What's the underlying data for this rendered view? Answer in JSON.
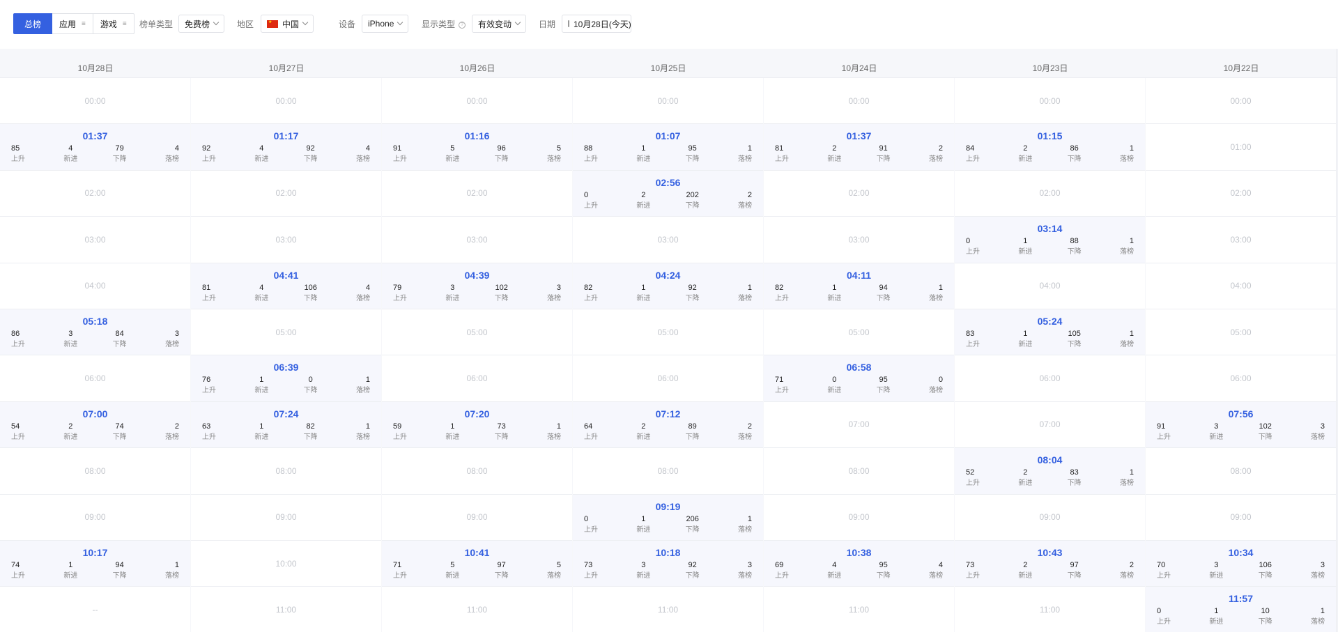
{
  "toolbar": {
    "segments": [
      {
        "label": "总榜",
        "active": true
      },
      {
        "label": "应用",
        "active": false
      },
      {
        "label": "游戏",
        "active": false
      }
    ],
    "list_type_label": "榜单类型",
    "list_type_value": "免费榜",
    "region_label": "地区",
    "region_value": "中国",
    "device_label": "设备",
    "device_value": "iPhone",
    "display_type_label": "显示类型",
    "display_type_value": "有效变动",
    "date_label": "日期",
    "date_value": "10月28日(今天)"
  },
  "stat_keys": [
    "上升",
    "新进",
    "下降",
    "落榜"
  ],
  "columns": [
    {
      "date": "10月28日",
      "rows": [
        {
          "time": "00:00"
        },
        {
          "time": "01:37",
          "stats": [
            85,
            4,
            79,
            4
          ]
        },
        {
          "time": "02:00"
        },
        {
          "time": "03:00"
        },
        {
          "time": "04:00"
        },
        {
          "time": "05:18",
          "stats": [
            86,
            3,
            84,
            3
          ]
        },
        {
          "time": "06:00"
        },
        {
          "time": "07:00",
          "stats": [
            54,
            2,
            74,
            2
          ]
        },
        {
          "time": "08:00"
        },
        {
          "time": "09:00"
        },
        {
          "time": "10:17",
          "stats": [
            74,
            1,
            94,
            1
          ]
        },
        {
          "time": "--"
        }
      ]
    },
    {
      "date": "10月27日",
      "rows": [
        {
          "time": "00:00"
        },
        {
          "time": "01:17",
          "stats": [
            92,
            4,
            92,
            4
          ]
        },
        {
          "time": "02:00"
        },
        {
          "time": "03:00"
        },
        {
          "time": "04:41",
          "stats": [
            81,
            4,
            106,
            4
          ]
        },
        {
          "time": "05:00"
        },
        {
          "time": "06:39",
          "stats": [
            76,
            1,
            0,
            1
          ]
        },
        {
          "time": "07:24",
          "stats": [
            63,
            1,
            82,
            1
          ]
        },
        {
          "time": "08:00"
        },
        {
          "time": "09:00"
        },
        {
          "time": "10:00"
        },
        {
          "time": "11:00"
        }
      ]
    },
    {
      "date": "10月26日",
      "rows": [
        {
          "time": "00:00"
        },
        {
          "time": "01:16",
          "stats": [
            91,
            5,
            96,
            5
          ]
        },
        {
          "time": "02:00"
        },
        {
          "time": "03:00"
        },
        {
          "time": "04:39",
          "stats": [
            79,
            3,
            102,
            3
          ]
        },
        {
          "time": "05:00"
        },
        {
          "time": "06:00"
        },
        {
          "time": "07:20",
          "stats": [
            59,
            1,
            73,
            1
          ]
        },
        {
          "time": "08:00"
        },
        {
          "time": "09:00"
        },
        {
          "time": "10:41",
          "stats": [
            71,
            5,
            97,
            5
          ]
        },
        {
          "time": "11:00"
        }
      ]
    },
    {
      "date": "10月25日",
      "rows": [
        {
          "time": "00:00"
        },
        {
          "time": "01:07",
          "stats": [
            88,
            1,
            95,
            1
          ]
        },
        {
          "time": "02:56",
          "stats": [
            0,
            2,
            202,
            2
          ]
        },
        {
          "time": "03:00"
        },
        {
          "time": "04:24",
          "stats": [
            82,
            1,
            92,
            1
          ]
        },
        {
          "time": "05:00"
        },
        {
          "time": "06:00"
        },
        {
          "time": "07:12",
          "stats": [
            64,
            2,
            89,
            2
          ]
        },
        {
          "time": "08:00"
        },
        {
          "time": "09:19",
          "stats": [
            0,
            1,
            206,
            1
          ]
        },
        {
          "time": "10:18",
          "stats": [
            73,
            3,
            92,
            3
          ]
        },
        {
          "time": "11:00"
        }
      ]
    },
    {
      "date": "10月24日",
      "rows": [
        {
          "time": "00:00"
        },
        {
          "time": "01:37",
          "stats": [
            81,
            2,
            91,
            2
          ]
        },
        {
          "time": "02:00"
        },
        {
          "time": "03:00"
        },
        {
          "time": "04:11",
          "stats": [
            82,
            1,
            94,
            1
          ]
        },
        {
          "time": "05:00"
        },
        {
          "time": "06:58",
          "stats": [
            71,
            0,
            95,
            0
          ]
        },
        {
          "time": "07:00"
        },
        {
          "time": "08:00"
        },
        {
          "time": "09:00"
        },
        {
          "time": "10:38",
          "stats": [
            69,
            4,
            95,
            4
          ]
        },
        {
          "time": "11:00"
        }
      ]
    },
    {
      "date": "10月23日",
      "rows": [
        {
          "time": "00:00"
        },
        {
          "time": "01:15",
          "stats": [
            84,
            2,
            86,
            1
          ]
        },
        {
          "time": "02:00"
        },
        {
          "time": "03:14",
          "stats": [
            0,
            1,
            88,
            1
          ]
        },
        {
          "time": "04:00"
        },
        {
          "time": "05:24",
          "stats": [
            83,
            1,
            105,
            1
          ]
        },
        {
          "time": "06:00"
        },
        {
          "time": "07:00"
        },
        {
          "time": "08:04",
          "stats": [
            52,
            2,
            83,
            1
          ]
        },
        {
          "time": "09:00"
        },
        {
          "time": "10:43",
          "stats": [
            73,
            2,
            97,
            2
          ]
        },
        {
          "time": "11:00"
        }
      ]
    },
    {
      "date": "10月22日",
      "rows": [
        {
          "time": "00:00"
        },
        {
          "time": "01:00"
        },
        {
          "time": "02:00"
        },
        {
          "time": "03:00"
        },
        {
          "time": "04:00"
        },
        {
          "time": "05:00"
        },
        {
          "time": "06:00"
        },
        {
          "time": "07:56",
          "stats": [
            91,
            3,
            102,
            3
          ]
        },
        {
          "time": "08:00"
        },
        {
          "time": "09:00"
        },
        {
          "time": "10:34",
          "stats": [
            70,
            3,
            106,
            3
          ]
        },
        {
          "time": "11:57",
          "stats": [
            0,
            1,
            10,
            1
          ]
        }
      ]
    }
  ],
  "colors": {
    "accent": "#3460e0",
    "filled_cell_bg": "#f6f7fd",
    "empty_time": "#c3c6cc"
  }
}
